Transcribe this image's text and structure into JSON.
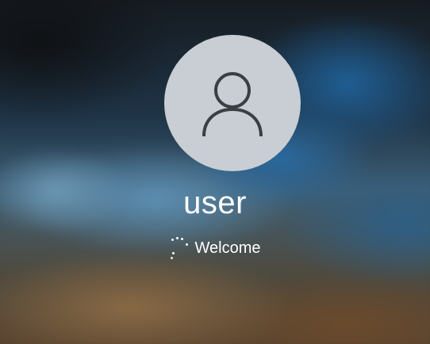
{
  "lock_screen": {
    "avatar_icon": "user-silhouette-icon",
    "username": "user",
    "status_text": "Welcome",
    "spinner_icon": "loading-dots-icon"
  },
  "colors": {
    "avatar_background": "#c8ced4",
    "avatar_glyph": "#3a3f44",
    "text": "#ffffff"
  }
}
